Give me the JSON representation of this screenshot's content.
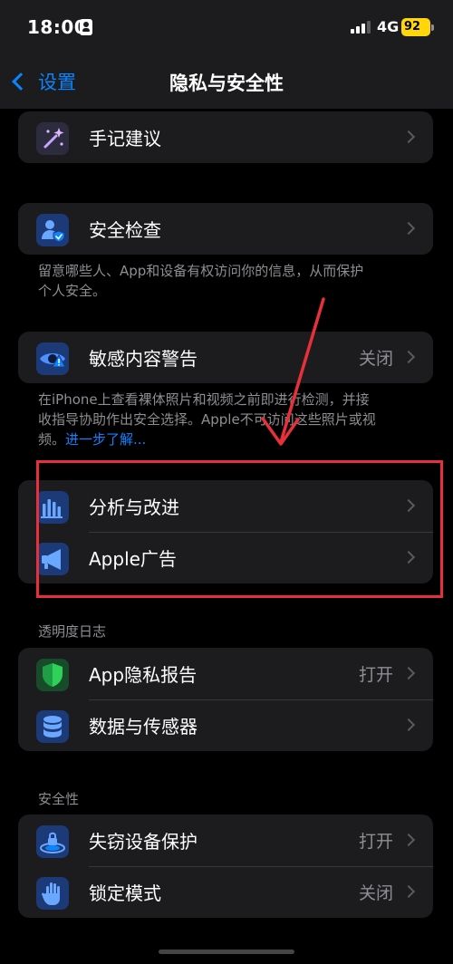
{
  "status_bar": {
    "time": "18:00",
    "network": "4G",
    "battery": "92"
  },
  "nav": {
    "back_label": "设置",
    "title": "隐私与安全性"
  },
  "rows": {
    "handwriting": {
      "label": "手记建议",
      "icon": "sparkles-icon"
    },
    "safety_check": {
      "label": "安全检查",
      "icon": "person-shield-icon"
    },
    "sensitive_content": {
      "label": "敏感内容警告",
      "value": "关闭",
      "icon": "eye-warning-icon"
    },
    "analytics": {
      "label": "分析与改进",
      "icon": "bar-chart-icon"
    },
    "apple_ads": {
      "label": "Apple广告",
      "icon": "megaphone-icon"
    },
    "app_privacy_report": {
      "label": "App隐私报告",
      "value": "打开",
      "icon": "shield-icon"
    },
    "data_sensors": {
      "label": "数据与传感器",
      "icon": "database-icon"
    },
    "stolen_device": {
      "label": "失窃设备保护",
      "value": "打开",
      "icon": "device-lock-icon"
    },
    "lockdown": {
      "label": "锁定模式",
      "value": "关闭",
      "icon": "hand-icon"
    }
  },
  "footers": {
    "safety_check_line1": "留意哪些人、App和设备有权访问你的信息，从而保护",
    "safety_check_line2": "个人安全。",
    "sensitive_line1": "在iPhone上查看裸体照片和视频之前即进行检测，并接",
    "sensitive_line2": "收指导协助作出安全选择。Apple不可访问这些照片或视",
    "sensitive_line3": "频。",
    "sensitive_link": "进一步了解..."
  },
  "sections": {
    "transparency_log": "透明度日志",
    "security": "安全性"
  },
  "colors": {
    "accent": "#0a84ff",
    "background": "#000000",
    "card": "#1c1c1e",
    "annotation": "#e8303c",
    "battery": "#ffd60a"
  }
}
